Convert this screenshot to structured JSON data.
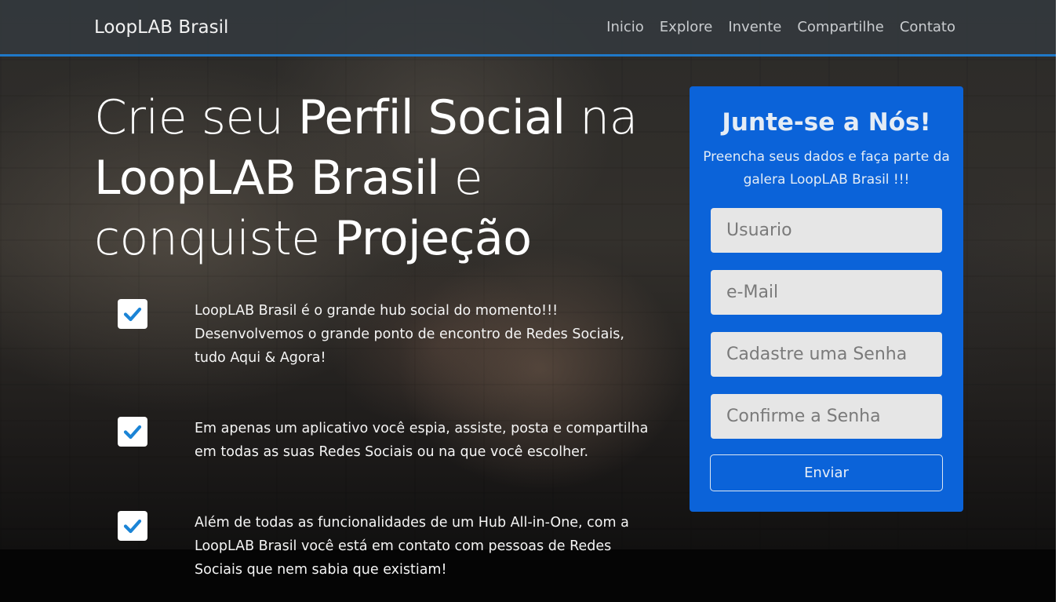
{
  "navbar": {
    "brand": "LoopLAB Brasil",
    "links": [
      "Inicio",
      "Explore",
      "Invente",
      "Compartilhe",
      "Contato"
    ],
    "accent_color": "#1f78c8"
  },
  "hero": {
    "headline": {
      "l1_light_a": "Crie seu ",
      "l1_bold": "Perfil Social",
      "l1_light_b": " na",
      "l2_bold": "LoopLAB Brasil",
      "l2_light": " e",
      "l3_light": "conquiste ",
      "l3_bold": "Projeção"
    },
    "features": [
      "LoopLAB Brasil é o grande hub social do momento!!! Desenvolvemos o grande ponto de encontro de Redes Sociais, tudo Aqui & Agora!",
      "Em apenas um aplicativo você espia, assiste, posta e compartilha em todas as suas Redes Sociais ou na que você escolher.",
      "Além de todas as funcionalidades de um Hub All-in-One, com a LoopLAB Brasil você está em contato com pessoas de Redes Sociais que nem sabia que existiam!"
    ],
    "check_color": "#1b84d6"
  },
  "signup": {
    "title": "Junte-se a Nós!",
    "subtitle": "Preencha seus dados e faça parte da galera LoopLAB Brasil !!!",
    "fields": [
      {
        "placeholder": "Usuario",
        "value": ""
      },
      {
        "placeholder": "e-Mail",
        "value": ""
      },
      {
        "placeholder": "Cadastre uma Senha",
        "value": ""
      },
      {
        "placeholder": "Confirme a Senha",
        "value": ""
      }
    ],
    "submit_label": "Enviar",
    "card_color": "#0b63d9"
  }
}
